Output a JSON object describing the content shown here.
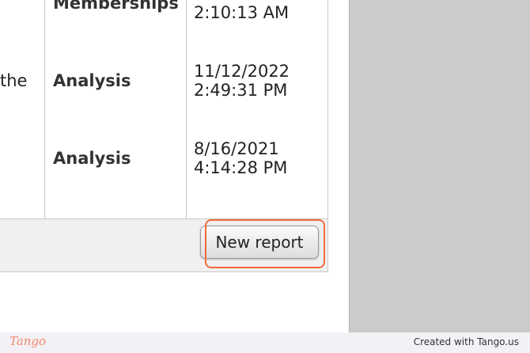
{
  "table": {
    "rows": [
      {
        "left_text": "",
        "name": "Memberships",
        "date": "",
        "time": "2:10:13 AM"
      },
      {
        "left_text": "the",
        "name": "Analysis",
        "date": "11/12/2022",
        "time": "2:49:31 PM"
      },
      {
        "left_text": "",
        "name": "Analysis",
        "date": "8/16/2021",
        "time": "4:14:28 PM"
      }
    ]
  },
  "footer": {
    "new_report_label": "New report"
  },
  "tango": {
    "logo_text": "Tango",
    "created_with": "Created with Tango.us"
  },
  "colors": {
    "highlight": "#f06a3a",
    "side_panel": "#cbcbcb"
  }
}
